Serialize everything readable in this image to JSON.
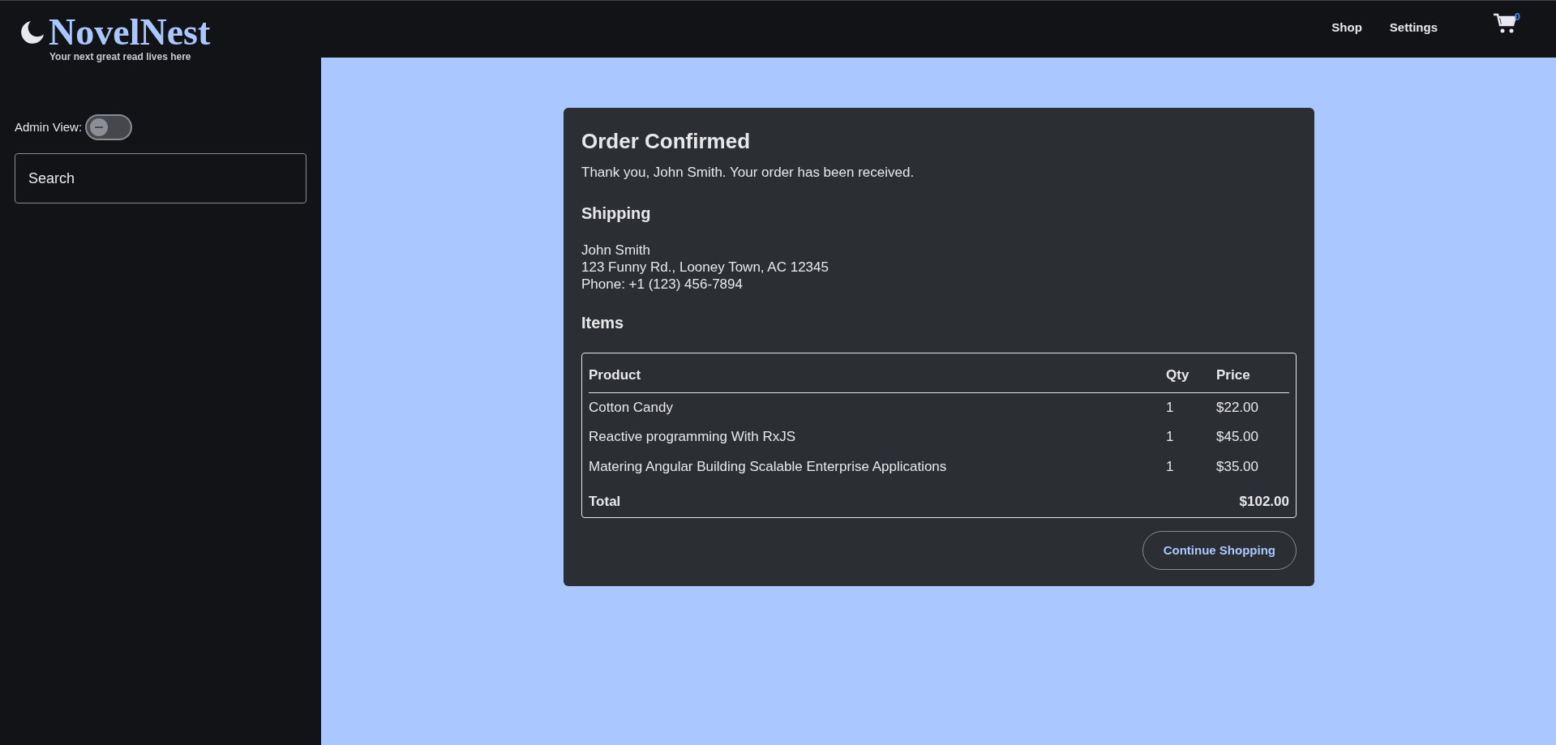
{
  "brand": {
    "name": "NovelNest",
    "tagline": "Your next great read lives here"
  },
  "nav": [
    {
      "label": "Shop"
    },
    {
      "label": "Settings"
    }
  ],
  "cart": {
    "count": "0"
  },
  "sidebar": {
    "admin_label": "Admin View:",
    "admin_on": false,
    "search": {
      "placeholder": "Search"
    }
  },
  "order": {
    "title": "Order Confirmed",
    "message": "Thank you, John Smith. Your order has been received.",
    "shipping_title": "Shipping",
    "shipping_lines": [
      "John Smith",
      "123 Funny Rd., Looney Town, AC 12345",
      "Phone: +1 (123) 456-7894"
    ],
    "items_title": "Items",
    "columns": [
      "Product",
      "Qty",
      "Price"
    ],
    "rows": [
      {
        "product": "Cotton Candy",
        "qty": "1",
        "price": "$22.00"
      },
      {
        "product": "Reactive programming With RxJS",
        "qty": "1",
        "price": "$45.00"
      },
      {
        "product": "Matering Angular Building Scalable Enterprise Applications",
        "qty": "1",
        "price": "$35.00"
      }
    ],
    "total_label": "Total",
    "total": "$102.00",
    "button": "Continue Shopping"
  }
}
